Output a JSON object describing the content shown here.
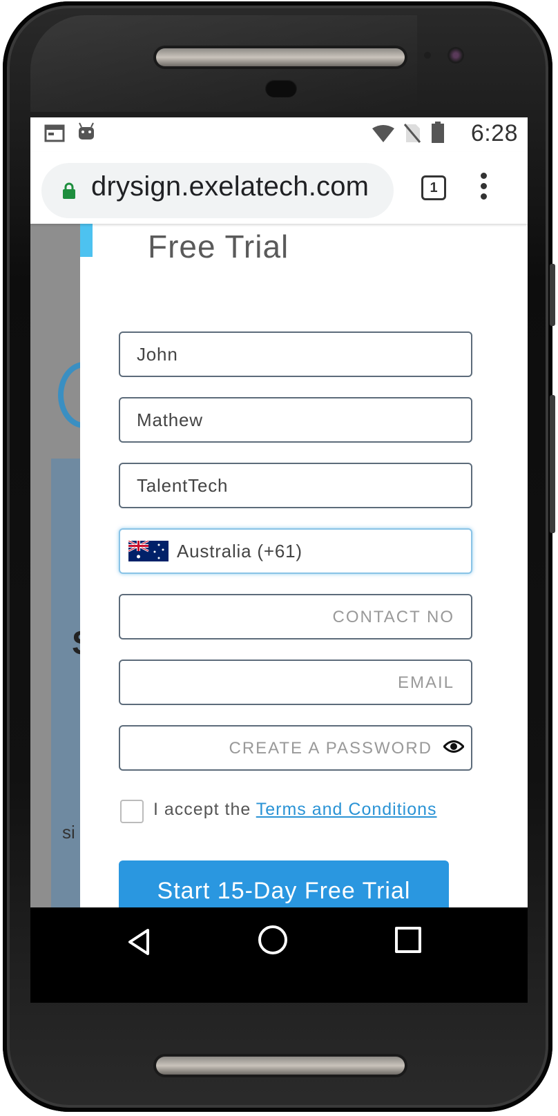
{
  "statusbar": {
    "time": "6:28",
    "icons": [
      "calendar-icon",
      "android-icon",
      "wifi-icon",
      "no-sim-icon",
      "battery-icon"
    ]
  },
  "browser": {
    "url": "drysign.exelatech.com",
    "tab_count": "1"
  },
  "form": {
    "title": "Free Trial",
    "first_name": "John",
    "last_name": "Mathew",
    "company": "TalentTech",
    "country": "Australia (+61)",
    "contact_placeholder": "CONTACT NO",
    "email_placeholder": "EMAIL",
    "password_placeholder": "CREATE A PASSWORD",
    "accept_prefix": "I accept the",
    "terms_link": "Terms and Conditions",
    "submit_label": "Start 15-Day Free Trial"
  },
  "background": {
    "letter": "S",
    "fragment": "si"
  },
  "colors": {
    "accent": "#2a97e0",
    "link": "#2a93d5",
    "bar_accent": "#4dc2f0"
  }
}
